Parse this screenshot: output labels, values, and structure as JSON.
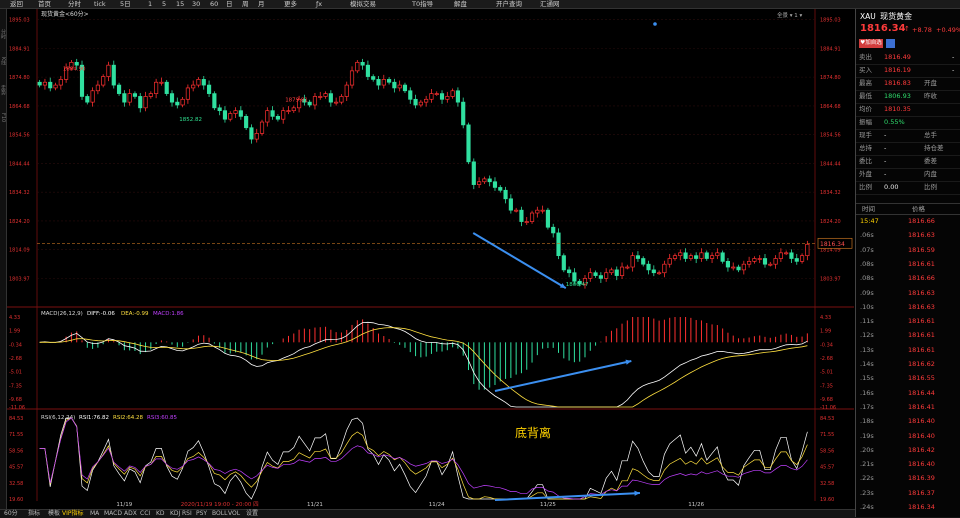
{
  "toolbar": {
    "items": [
      "返回",
      "首页",
      "分时",
      "tick",
      "5日",
      "1",
      "5",
      "15",
      "30",
      "60",
      "日",
      "周",
      "月",
      "更多",
      "ƒx",
      "模拟交易",
      "T0指导",
      "解盘",
      "开户查询",
      "汇通网"
    ]
  },
  "left_strip": [
    "分时",
    "K线",
    "走势",
    "F10"
  ],
  "chart": {
    "instrument_label": "现货黄金<60分>",
    "period_selector": "全景 ▾ 1 ▾",
    "current_price_tag": "1816.34",
    "price_axis": [
      "1895.03",
      "1884.91",
      "1874.80",
      "1864.68",
      "1854.56",
      "1844.44",
      "1834.32",
      "1824.20",
      "1814.09",
      "1803.97"
    ],
    "price_annotations": {
      "high1": "1884.90",
      "high2": "1879.81",
      "low1": "1852.82",
      "low2": "1800.47"
    },
    "macd_header": {
      "name": "MACD(26,12,9)",
      "diff": "DIFF:-0.06",
      "dea": "DEA:-0.99",
      "macd": "MACD:1.86"
    },
    "macd_axis": [
      "4.33",
      "1.99",
      "-0.34",
      "-2.68",
      "-5.01",
      "-7.35",
      "-9.68",
      "-11.06"
    ],
    "rsi_header": {
      "name": "RSI(6,12,24)",
      "rsi1": "RSI1:76.82",
      "rsi2": "RSI2:64.28",
      "rsi3": "RSI3:60.85"
    },
    "rsi_axis": [
      "84.53",
      "71.55",
      "58.56",
      "45.57",
      "32.58",
      "19.60"
    ],
    "divergence_label": "底背离",
    "x_axis": [
      "11/19",
      "11/21",
      "11/24",
      "11/25",
      "11/26"
    ],
    "cursor_time": "2020/11/19 19:00 - 20:00 四",
    "colors": {
      "up": "#ff3030",
      "down": "#30e0a0",
      "diff": "#ffffff",
      "dea": "#ffe040",
      "rsi3": "#c040ff",
      "arrow": "#3b8ff0"
    }
  },
  "chart_data": [
    {
      "type": "candlestick",
      "title": "现货黄金<60分>",
      "ylim": [
        1795,
        1897
      ],
      "x_labels": [
        "11/19",
        "11/21",
        "11/24",
        "11/25",
        "11/26"
      ],
      "close": [
        1872,
        1873,
        1871,
        1872,
        1874,
        1878,
        1880,
        1879,
        1868,
        1866,
        1870,
        1872,
        1875,
        1879,
        1872,
        1869,
        1866,
        1869,
        1868,
        1864,
        1868,
        1869,
        1873,
        1873,
        1869,
        1866,
        1865,
        1867,
        1871,
        1872,
        1874,
        1872,
        1869,
        1864,
        1863,
        1860,
        1862,
        1863,
        1861,
        1857,
        1853,
        1855,
        1859,
        1863,
        1861,
        1860,
        1863,
        1863,
        1864,
        1867,
        1866,
        1865,
        1868,
        1868,
        1869,
        1866,
        1866,
        1868,
        1872,
        1877,
        1880,
        1879,
        1875,
        1874,
        1872,
        1874,
        1873,
        1871,
        1872,
        1870,
        1867,
        1865,
        1866,
        1867,
        1869,
        1869,
        1867,
        1868,
        1870,
        1866,
        1858,
        1845,
        1837,
        1838,
        1839,
        1838,
        1836,
        1835,
        1832,
        1828,
        1828,
        1824,
        1824,
        1827,
        1828,
        1828,
        1822,
        1820,
        1812,
        1807,
        1806,
        1803,
        1802,
        1804,
        1806,
        1805,
        1804,
        1806,
        1807,
        1805,
        1808,
        1808,
        1812,
        1811,
        1809,
        1807,
        1806,
        1806,
        1809,
        1811,
        1812,
        1813,
        1811,
        1812,
        1811,
        1813,
        1811,
        1812,
        1813,
        1810,
        1808,
        1808,
        1807,
        1809,
        1810,
        1811,
        1811,
        1809,
        1809,
        1811,
        1813,
        1813,
        1811,
        1810,
        1812,
        1816
      ],
      "price_axis_ticks": [
        1895.03,
        1884.91,
        1874.8,
        1864.68,
        1854.56,
        1844.44,
        1834.32,
        1824.2,
        1814.09,
        1803.97
      ],
      "current_price": 1816.34,
      "annotations": [
        {
          "label": "1884.90"
        },
        {
          "label": "1879.81"
        },
        {
          "label": "1852.82"
        },
        {
          "label": "1800.47"
        }
      ]
    },
    {
      "type": "bar",
      "title": "MACD(26,12,9)",
      "ylim": [
        -11.06,
        4.33
      ],
      "series": [
        {
          "name": "DIFF",
          "latest": -0.06
        },
        {
          "name": "DEA",
          "latest": -0.99
        },
        {
          "name": "MACD",
          "latest": 1.86
        }
      ]
    },
    {
      "type": "line",
      "title": "RSI(6,12,24)",
      "ylim": [
        19.6,
        84.53
      ],
      "series": [
        {
          "name": "RSI1",
          "latest": 76.82
        },
        {
          "name": "RSI2",
          "latest": 64.28
        },
        {
          "name": "RSI3",
          "latest": 60.85
        }
      ]
    }
  ],
  "quote": {
    "code": "XAU",
    "name": "现货黄金",
    "price": "1816.34",
    "arrow": "↑",
    "change": "+8.78",
    "change_pct": "+0.49%",
    "tag1": "加自选",
    "rows": [
      {
        "label": "卖出",
        "value": "1816.49",
        "label2": "",
        "value2": "-"
      },
      {
        "label": "买入",
        "value": "1816.19",
        "label2": "",
        "value2": "-"
      },
      {
        "label": "最高",
        "value": "1816.83",
        "label2": "开盘",
        "value2": ""
      },
      {
        "label": "最低",
        "value": "1806.93",
        "label2": "昨收",
        "value2": ""
      },
      {
        "label": "均价",
        "value": "1810.35",
        "label2": "",
        "value2": ""
      },
      {
        "label": "振幅",
        "value": "0.55%",
        "label2": "",
        "value2": ""
      },
      {
        "label": "现手",
        "value": "-",
        "label2": "总手",
        "value2": ""
      },
      {
        "label": "总持",
        "value": "-",
        "label2": "持仓差",
        "value2": ""
      },
      {
        "label": "委比",
        "value": "-",
        "label2": "委差",
        "value2": ""
      },
      {
        "label": "外盘",
        "value": "-",
        "label2": "内盘",
        "value2": ""
      },
      {
        "label": "比例",
        "value": "0.00",
        "label2": "比例",
        "value2": ""
      }
    ],
    "ticks_header": {
      "time": "时间",
      "price": "价格"
    },
    "ticks": [
      {
        "t": "15:47",
        "p": "1816.66"
      },
      {
        "t": ".06s",
        "p": "1816.63"
      },
      {
        "t": ".07s",
        "p": "1816.59"
      },
      {
        "t": ".08s",
        "p": "1816.61"
      },
      {
        "t": ".08s",
        "p": "1816.66"
      },
      {
        "t": ".09s",
        "p": "1816.63"
      },
      {
        "t": ".10s",
        "p": "1816.63"
      },
      {
        "t": ".11s",
        "p": "1816.61"
      },
      {
        "t": ".12s",
        "p": "1816.61"
      },
      {
        "t": ".13s",
        "p": "1816.61"
      },
      {
        "t": ".14s",
        "p": "1816.62"
      },
      {
        "t": ".15s",
        "p": "1816.55"
      },
      {
        "t": ".16s",
        "p": "1816.44"
      },
      {
        "t": ".17s",
        "p": "1816.41"
      },
      {
        "t": ".18s",
        "p": "1816.40"
      },
      {
        "t": ".19s",
        "p": "1816.40"
      },
      {
        "t": ".20s",
        "p": "1816.42"
      },
      {
        "t": ".21s",
        "p": "1816.40"
      },
      {
        "t": ".22s",
        "p": "1816.39"
      },
      {
        "t": ".23s",
        "p": "1816.37"
      },
      {
        "t": ".24s",
        "p": "1816.34"
      }
    ]
  },
  "bottom_tabs": [
    "60分",
    "指标",
    "模板",
    "VIP指标",
    "MA",
    "MACD",
    "ADX",
    "CCI",
    "KD",
    "KDJ",
    "RSI",
    "PSY",
    "BOLL",
    "VOL",
    "设置"
  ]
}
